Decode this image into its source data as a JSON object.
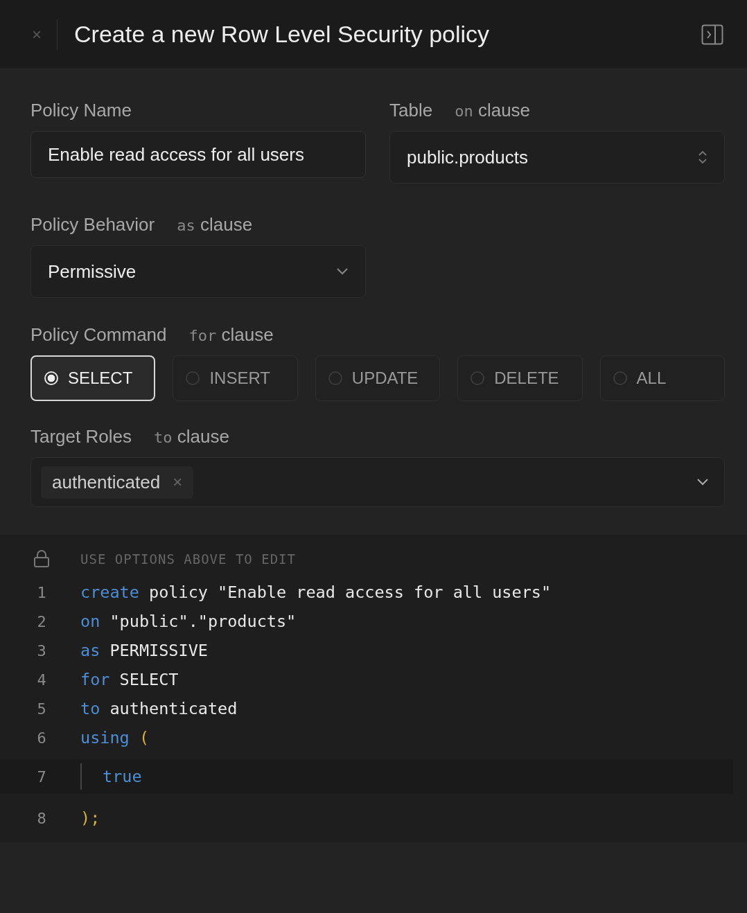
{
  "header": {
    "close": "×",
    "title": "Create a new Row Level Security policy"
  },
  "policy_name": {
    "label": "Policy Name",
    "value": "Enable read access for all users"
  },
  "table": {
    "label": "Table",
    "clause_keyword": "on",
    "clause": "clause",
    "value": "public.products"
  },
  "behavior": {
    "label": "Policy Behavior",
    "clause_keyword": "as",
    "clause": "clause",
    "value": "Permissive"
  },
  "command": {
    "label": "Policy Command",
    "clause_keyword": "for",
    "clause": "clause",
    "options": [
      {
        "label": "SELECT",
        "selected": true
      },
      {
        "label": "INSERT",
        "selected": false
      },
      {
        "label": "UPDATE",
        "selected": false
      },
      {
        "label": "DELETE",
        "selected": false
      },
      {
        "label": "ALL",
        "selected": false
      }
    ]
  },
  "roles": {
    "label": "Target Roles",
    "clause_keyword": "to",
    "clause": "clause",
    "tags": [
      {
        "label": "authenticated",
        "remove": "×"
      }
    ]
  },
  "code": {
    "notice": "USE OPTIONS ABOVE TO EDIT",
    "lines": [
      {
        "number": "1",
        "kind": "plain",
        "tokens": [
          {
            "text": "create",
            "kind": "keyword"
          },
          {
            "text": " policy \"Enable read access for all users\"",
            "kind": "text"
          }
        ]
      },
      {
        "number": "2",
        "kind": "plain",
        "tokens": [
          {
            "text": "on",
            "kind": "keyword"
          },
          {
            "text": " \"public\".\"products\"",
            "kind": "text"
          }
        ]
      },
      {
        "number": "3",
        "kind": "plain",
        "tokens": [
          {
            "text": "as",
            "kind": "keyword"
          },
          {
            "text": " PERMISSIVE",
            "kind": "text"
          }
        ]
      },
      {
        "number": "4",
        "kind": "plain",
        "tokens": [
          {
            "text": "for",
            "kind": "keyword"
          },
          {
            "text": " SELECT",
            "kind": "text"
          }
        ]
      },
      {
        "number": "5",
        "kind": "plain",
        "tokens": [
          {
            "text": "to",
            "kind": "keyword"
          },
          {
            "text": " authenticated",
            "kind": "text"
          }
        ]
      },
      {
        "number": "6",
        "kind": "plain",
        "tokens": [
          {
            "text": "using",
            "kind": "keyword"
          },
          {
            "text": " (",
            "kind": "paren"
          }
        ]
      },
      {
        "number": "7",
        "kind": "block",
        "tokens": [
          {
            "text": "true",
            "kind": "keyword"
          }
        ]
      },
      {
        "number": "8",
        "kind": "plain",
        "tokens": [
          {
            "text": ");",
            "kind": "paren"
          }
        ]
      }
    ]
  }
}
